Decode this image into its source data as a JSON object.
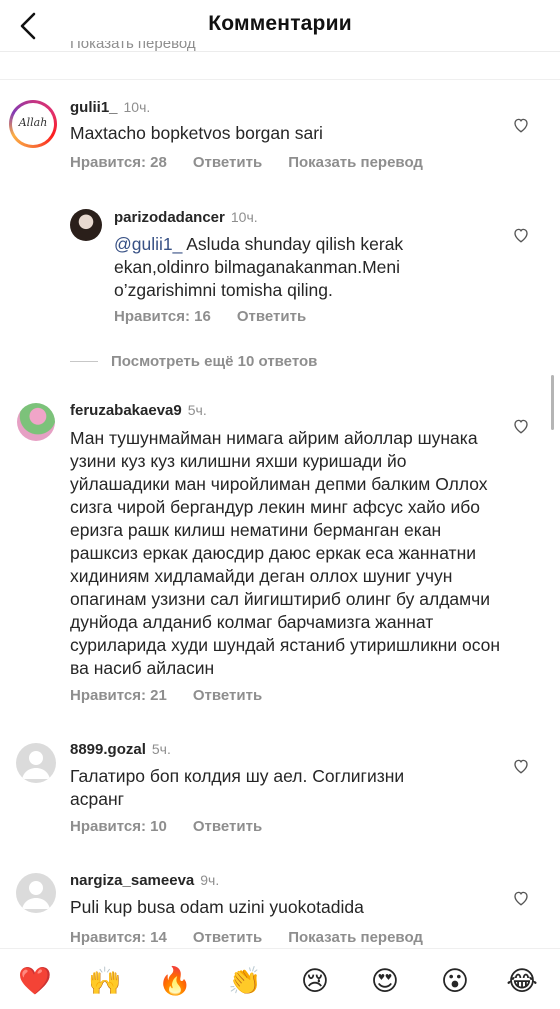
{
  "header": {
    "title": "Комментарии",
    "clipped_text": "Показать перевод"
  },
  "comments": [
    {
      "username": "gulii1_",
      "time": "10ч.",
      "text": "Maxtacho bopketvos borgan sari",
      "likes": "Нравится: 28",
      "reply": "Ответить",
      "translate": "Показать перевод",
      "avatar_text": "Allah"
    },
    {
      "username": "parizodadancer",
      "time": "10ч.",
      "mention": "@gulii1_",
      "text": " Asluda shunday qilish kerak ekan,oldinro bilmaganakanman.Meni o’zgarishimni tomisha qiling.",
      "likes": "Нравится: 16",
      "reply": "Ответить"
    },
    {
      "username": "feruzabakaeva9",
      "time": "5ч.",
      "text": "Ман тушунмайман нимага айрим айоллар шунака узини куз куз килишни яхши куришади йо уйлашадики ман чиройлиман депми балким Оллох сизга чирой бергандур лекин минг афсус хайо ибо еризга рашк килиш нематини берманган екан рашксиз еркак даюсдир даюс еркак еса жаннатни хидиниям хидламайди деган оллох шуниг учун опагинам узизни сал йигиштириб олинг бу алдамчи дунйода алданиб колмаг барчамизга жаннат суриларида худи шундай ястаниб утиришликни осон ва насиб айласин",
      "likes": "Нравится: 21",
      "reply": "Ответить"
    },
    {
      "username": "8899.gozal",
      "time": "5ч.",
      "text": "Галатиро боп колдия шу аел. Соглигизни асранг",
      "likes": "Нравится: 10",
      "reply": "Ответить"
    },
    {
      "username": "nargiza_sameeva",
      "time": "9ч.",
      "text": "Puli kup busa odam uzini yuokotadida",
      "likes": "Нравится: 14",
      "reply": "Ответить",
      "translate": "Показать перевод"
    }
  ],
  "view_more_replies": "Посмотреть ещё 10 ответов",
  "emoji_bar": [
    "❤️",
    "🙌",
    "🔥",
    "👏",
    "😢",
    "😍",
    "😮",
    "😂"
  ],
  "colors": {
    "mention": "#385185",
    "muted": "#8e8e8e",
    "text": "#262626"
  }
}
